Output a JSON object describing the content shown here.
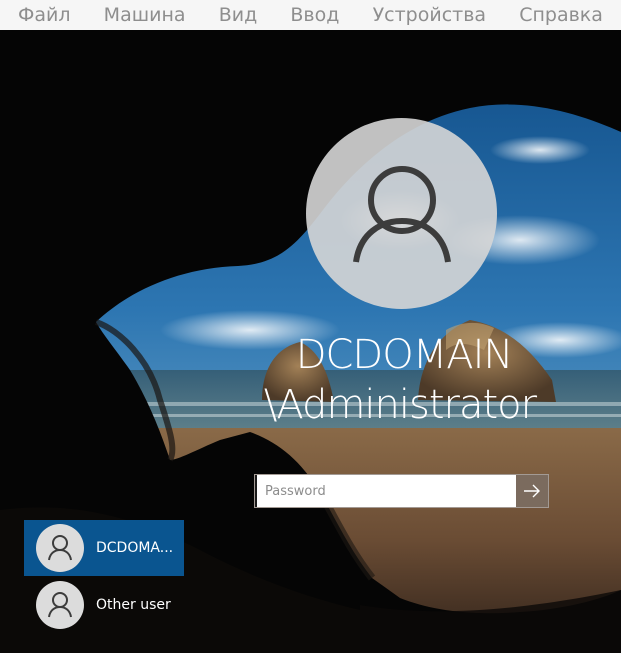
{
  "menu": {
    "items": [
      "Файл",
      "Машина",
      "Вид",
      "Ввод",
      "Устройства",
      "Справка"
    ]
  },
  "login": {
    "username_line1": "DCDOMAIN",
    "username_line2": "\\Administrator",
    "password_placeholder": "Password",
    "password_value": "",
    "submit_icon": "arrow-right-icon",
    "avatar_icon": "user-silhouette-icon"
  },
  "users": [
    {
      "label": "DCDOMA...",
      "selected": true,
      "icon": "user-silhouette-icon"
    },
    {
      "label": "Other user",
      "selected": false,
      "icon": "user-silhouette-icon"
    }
  ],
  "colors": {
    "menubar_bg": "#f6f6f6",
    "menubar_text": "#8e8e8e",
    "selected_tile": "#0a5590",
    "submit_button": "#7b6b5e",
    "avatar_bg": "#d6d6d6"
  }
}
